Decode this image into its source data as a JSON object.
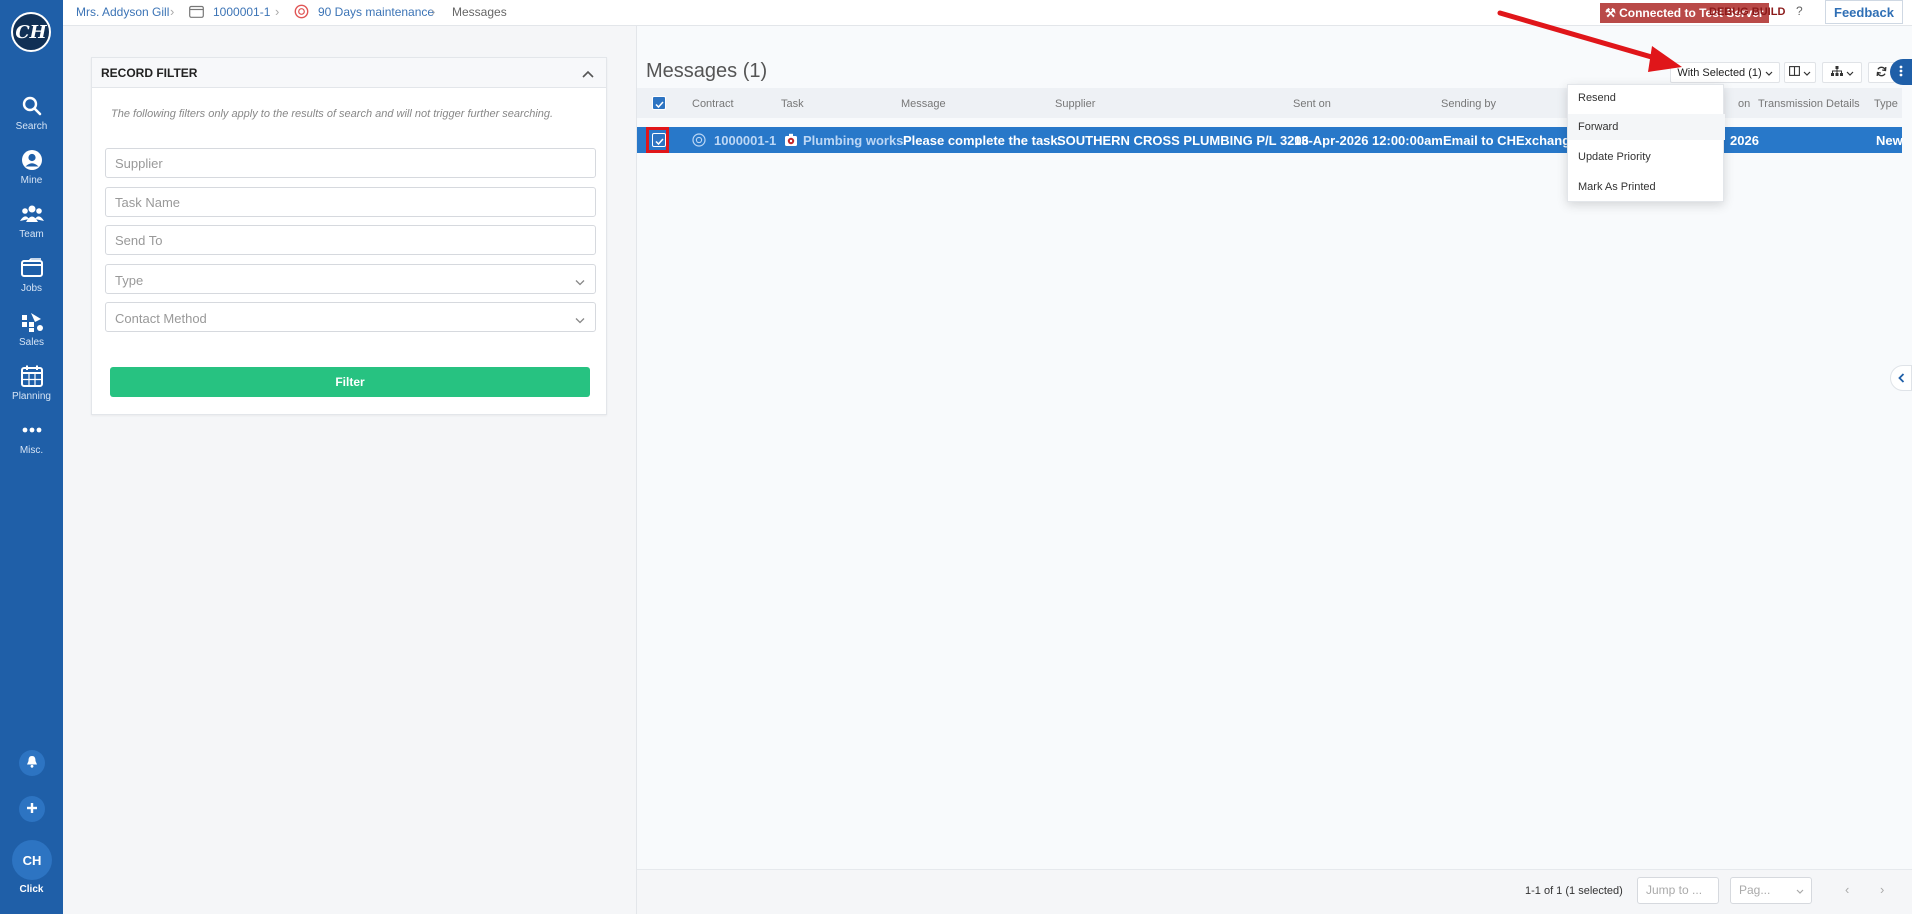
{
  "sidebar": {
    "logo": "CH",
    "items": [
      {
        "label": "Search",
        "icon": "search-icon"
      },
      {
        "label": "Mine",
        "icon": "user-icon"
      },
      {
        "label": "Team",
        "icon": "team-icon"
      },
      {
        "label": "Jobs",
        "icon": "folder-icon"
      },
      {
        "label": "Sales",
        "icon": "sales-icon"
      },
      {
        "label": "Planning",
        "icon": "calendar-icon"
      },
      {
        "label": "Misc.",
        "icon": "more-icon"
      }
    ],
    "user_initials": "CH",
    "user_label": "Click"
  },
  "breadcrumb": {
    "items": [
      "Mrs. Addyson Gill",
      "1000001-1",
      "90 Days maintenance",
      "Messages"
    ]
  },
  "topbar": {
    "server_badge": "Connected to Test Server",
    "debug_label": "DEBUG BUILD",
    "help_label": "?",
    "feedback_label": "Feedback"
  },
  "filter": {
    "title": "RECORD FILTER",
    "note": "The following filters only apply to the results of search and will not trigger further searching.",
    "supplier_placeholder": "Supplier",
    "task_name_placeholder": "Task Name",
    "send_to_placeholder": "Send To",
    "type_placeholder": "Type",
    "contact_method_placeholder": "Contact Method",
    "filter_button": "Filter"
  },
  "messages": {
    "title": "Messages (1)",
    "with_selected_label": "With Selected (1)",
    "columns": [
      "Contract",
      "Task",
      "Message",
      "Supplier",
      "Sent on",
      "Sending by",
      "on",
      "Transmission Details",
      "Type"
    ],
    "row": {
      "contract": "1000001-1",
      "task": "Plumbing works",
      "message": "Please complete the task.",
      "supplier": "SOUTHERN CROSS PLUMBING P/L 3206",
      "sent_on": "13-Apr-2026 12:00:00am",
      "sending_by": "Email to CHExchange@",
      "date_fragment": "2026",
      "type": "New"
    },
    "menu": [
      "Resend",
      "Forward",
      "Update Priority",
      "Mark As Printed"
    ],
    "pager": {
      "summary": "1-1 of 1 (1 selected)",
      "jump_placeholder": "Jump to ...",
      "page_placeholder": "Pag...",
      "prev": "‹",
      "next": "›"
    }
  },
  "colors": {
    "sidebar": "#1f5fa8",
    "selected_row": "#2878c9",
    "filter_button": "#27c281",
    "server_badge": "#b94a48",
    "annotation_red": "#e0161a"
  }
}
